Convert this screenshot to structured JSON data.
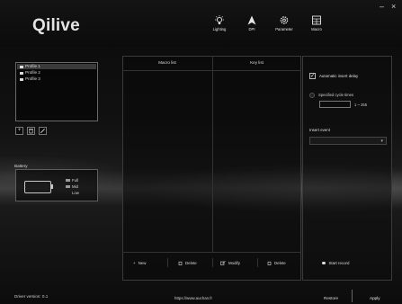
{
  "app": {
    "logo": "Qilive"
  },
  "nav": [
    {
      "label": "Lighting",
      "icon": "bulb-icon"
    },
    {
      "label": "DPI",
      "icon": "cursor-arrow-icon"
    },
    {
      "label": "Parameter",
      "icon": "gear-icon"
    },
    {
      "label": "Macro",
      "icon": "keyboard-icon"
    }
  ],
  "window_controls": {
    "minimize": "–",
    "close": "×"
  },
  "profiles": {
    "items": [
      {
        "label": "Profile 1",
        "selected": true
      },
      {
        "label": "Profile 2",
        "selected": false
      },
      {
        "label": "Profile 3",
        "selected": false
      }
    ],
    "tools": {
      "add": "+",
      "delete": "🗑",
      "edit": "✎"
    }
  },
  "battery": {
    "title": "Battery",
    "legend": [
      "Full",
      "Mid",
      "Low"
    ]
  },
  "macro": {
    "headers": {
      "macro_list": "Macro list",
      "key_list": "Key list"
    },
    "buttons": {
      "new": "New",
      "delete_macro": "Delete",
      "modify": "Modify",
      "delete_key": "Delete"
    }
  },
  "options": {
    "auto_insert_delay": {
      "label": "Automatic insert delay",
      "checked": true
    },
    "specified_cycle": {
      "label": "Specified cycle times",
      "value": "",
      "range": "1 ~ 255"
    },
    "insert_event": {
      "label": "Insert event",
      "value": ""
    },
    "start_record": "Start record"
  },
  "footer": {
    "driver_version": "Driver version: 0.1",
    "url": "https://www.auchan.fr",
    "restore": "Restore",
    "apply": "Apply"
  },
  "colors": {
    "background": "#0c0c0c",
    "text": "#d8d8d8",
    "border": "#3a3a3a"
  }
}
